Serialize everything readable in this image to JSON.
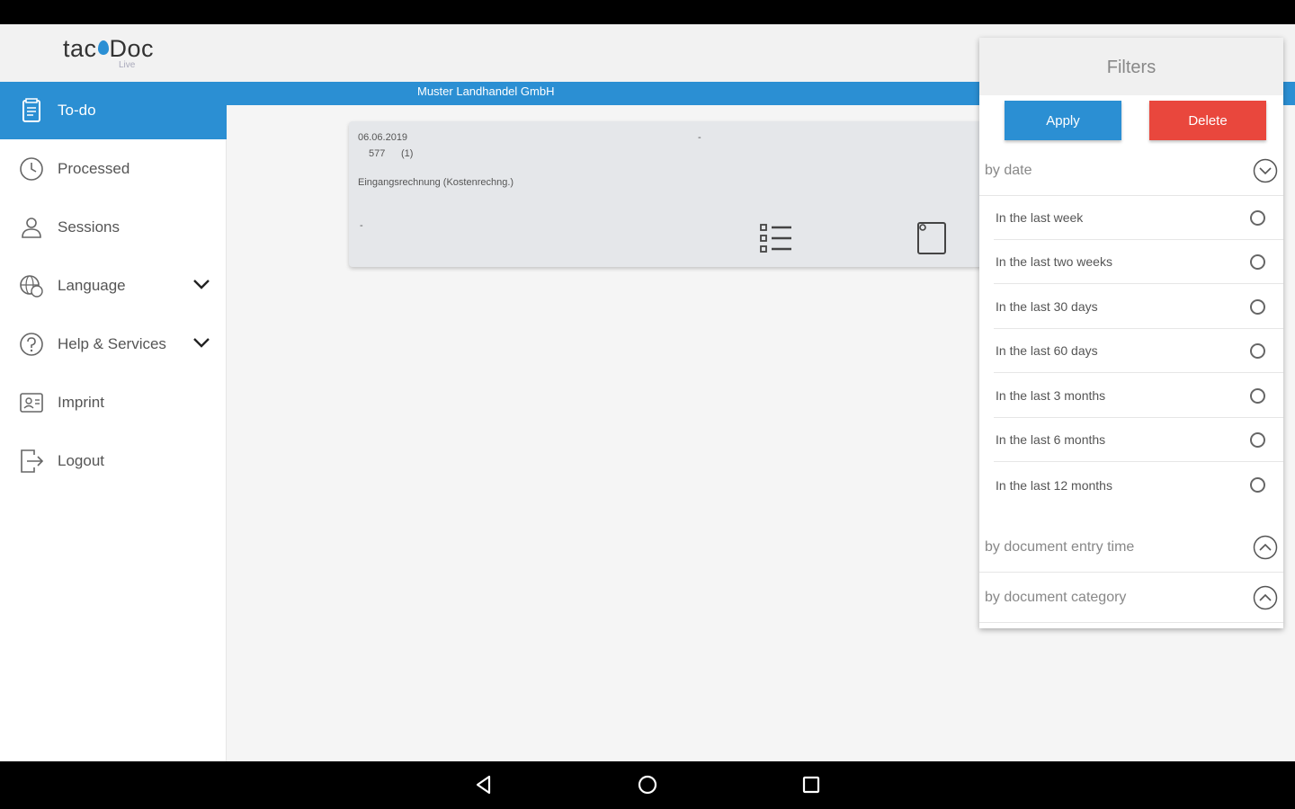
{
  "app": {
    "logo_main_left": "tac",
    "logo_main_right": "Doc",
    "logo_sub": "Live"
  },
  "sidebar": {
    "items": [
      {
        "label": "To-do",
        "icon": "todo-document-icon",
        "active": true
      },
      {
        "label": "Processed",
        "icon": "clock-icon"
      },
      {
        "label": "Sessions",
        "icon": "user-icon"
      },
      {
        "label": "Language",
        "icon": "language-icon",
        "expandable": true
      },
      {
        "label": "Help & Services",
        "icon": "help-icon",
        "expandable": true
      },
      {
        "label": "Imprint",
        "icon": "imprint-icon"
      },
      {
        "label": "Logout",
        "icon": "logout-icon"
      }
    ]
  },
  "main": {
    "company": "Muster Landhandel GmbH",
    "document": {
      "date": "06.06.2019",
      "dash": "-",
      "number": "577",
      "count": "(1)",
      "type": "Eingangsrechnung (Kostenrechng.)",
      "dash2": "-"
    }
  },
  "filters": {
    "title": "Filters",
    "apply_label": "Apply",
    "delete_label": "Delete",
    "sections": [
      {
        "label": "by date",
        "expanded": true
      },
      {
        "label": "by document entry time",
        "expanded": false
      },
      {
        "label": "by document category",
        "expanded": false
      }
    ],
    "date_options": [
      "In the last week",
      "In the last two weeks",
      "In the last 30 days",
      "In the last 60 days",
      "In the last 3 months",
      "In the last 6 months",
      "In the last 12 months"
    ]
  },
  "colors": {
    "accent": "#2b8fd3",
    "danger": "#e9473d"
  }
}
